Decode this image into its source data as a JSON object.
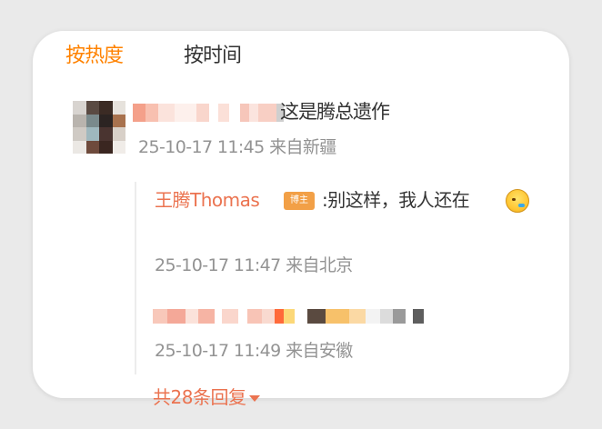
{
  "tabs": [
    {
      "label": "按热度",
      "active": true
    },
    {
      "label": "按时间",
      "active": false
    }
  ],
  "comment": {
    "text": "这是腾总遗作",
    "meta": "25-10-17 11:45 来自新疆"
  },
  "reply1": {
    "author": "王腾Thomas",
    "badge": "博主",
    "text": ":别这样，我人还在",
    "emoji_icon": "crying-laughing-face-icon",
    "meta": "25-10-17 11:47 来自北京"
  },
  "reply2": {
    "meta": "25-10-17 11:49 来自安徽"
  },
  "more_replies": {
    "label": "共28条回复"
  },
  "colors": {
    "accent_orange": "#ff8200",
    "name_link": "#eb7350",
    "badge_bg": "#f2a047",
    "text": "#333333",
    "meta": "#939393"
  }
}
